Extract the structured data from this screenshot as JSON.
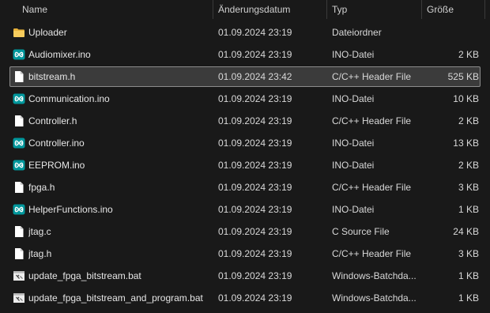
{
  "columns": {
    "name": "Name",
    "date": "Änderungsdatum",
    "type": "Typ",
    "size": "Größe"
  },
  "selected_index": 2,
  "files": [
    {
      "name": "Uploader",
      "date": "01.09.2024 23:19",
      "type": "Dateiordner",
      "size": "",
      "icon": "folder-icon"
    },
    {
      "name": "Audiomixer.ino",
      "date": "01.09.2024 23:19",
      "type": "INO-Datei",
      "size": "2 KB",
      "icon": "arduino-file-icon"
    },
    {
      "name": "bitstream.h",
      "date": "01.09.2024 23:42",
      "type": "C/C++ Header File",
      "size": "525 KB",
      "icon": "document-file-icon"
    },
    {
      "name": "Communication.ino",
      "date": "01.09.2024 23:19",
      "type": "INO-Datei",
      "size": "10 KB",
      "icon": "arduino-file-icon"
    },
    {
      "name": "Controller.h",
      "date": "01.09.2024 23:19",
      "type": "C/C++ Header File",
      "size": "2 KB",
      "icon": "document-file-icon"
    },
    {
      "name": "Controller.ino",
      "date": "01.09.2024 23:19",
      "type": "INO-Datei",
      "size": "13 KB",
      "icon": "arduino-file-icon"
    },
    {
      "name": "EEPROM.ino",
      "date": "01.09.2024 23:19",
      "type": "INO-Datei",
      "size": "2 KB",
      "icon": "arduino-file-icon"
    },
    {
      "name": "fpga.h",
      "date": "01.09.2024 23:19",
      "type": "C/C++ Header File",
      "size": "3 KB",
      "icon": "document-file-icon"
    },
    {
      "name": "HelperFunctions.ino",
      "date": "01.09.2024 23:19",
      "type": "INO-Datei",
      "size": "1 KB",
      "icon": "arduino-file-icon"
    },
    {
      "name": "jtag.c",
      "date": "01.09.2024 23:19",
      "type": "C Source File",
      "size": "24 KB",
      "icon": "document-file-icon"
    },
    {
      "name": "jtag.h",
      "date": "01.09.2024 23:19",
      "type": "C/C++ Header File",
      "size": "3 KB",
      "icon": "document-file-icon"
    },
    {
      "name": "update_fpga_bitstream.bat",
      "date": "01.09.2024 23:19",
      "type": "Windows-Batchda...",
      "size": "1 KB",
      "icon": "batch-file-icon"
    },
    {
      "name": "update_fpga_bitstream_and_program.bat",
      "date": "01.09.2024 23:19",
      "type": "Windows-Batchda...",
      "size": "1 KB",
      "icon": "batch-file-icon"
    }
  ],
  "colors": {
    "background": "#191919",
    "selection": "#3b3b3b",
    "folder": "#f2c14e",
    "arduino": "#00979c"
  }
}
